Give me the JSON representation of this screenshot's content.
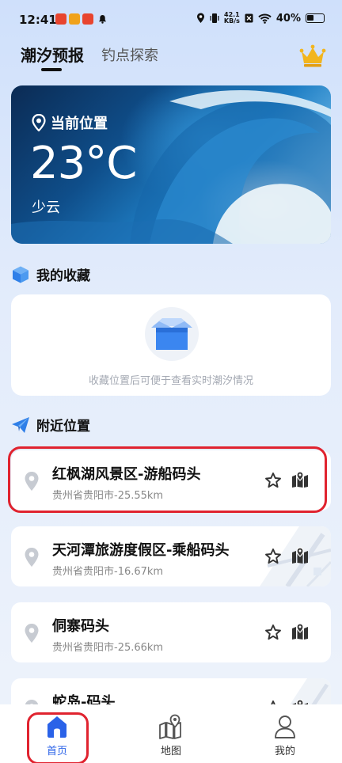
{
  "status_bar": {
    "time": "12:41",
    "speed_value": "42.1",
    "speed_unit": "KB/s",
    "battery": "40%"
  },
  "tabs": [
    {
      "label": "潮汐预报",
      "active": true
    },
    {
      "label": "钓点探索",
      "active": false
    }
  ],
  "hero": {
    "location_label": "当前位置",
    "temperature": "23°C",
    "weather": "少云"
  },
  "favorites": {
    "title": "我的收藏",
    "empty_text": "收藏位置后可便于查看实时潮汐情况"
  },
  "nearby": {
    "title": "附近位置",
    "items": [
      {
        "name": "红枫湖风景区-游船码头",
        "detail": "贵州省贵阳市-25.55km"
      },
      {
        "name": "天河潭旅游度假区-乘船码头",
        "detail": "贵州省贵阳市-16.67km"
      },
      {
        "name": "侗寨码头",
        "detail": "贵州省贵阳市-25.66km"
      },
      {
        "name": "蛇岛-码头",
        "detail": ""
      }
    ]
  },
  "bottom_nav": [
    {
      "label": "首页",
      "active": true
    },
    {
      "label": "地图",
      "active": false
    },
    {
      "label": "我的",
      "active": false
    }
  ],
  "colors": {
    "accent": "#2a62e8",
    "highlight": "#e0232f",
    "crown": "#f2b51d"
  }
}
